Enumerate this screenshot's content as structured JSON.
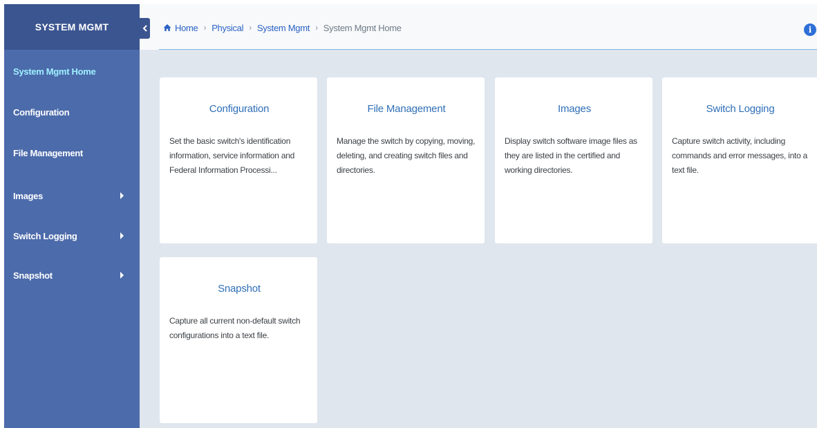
{
  "sidebar": {
    "title": "SYSTEM MGMT",
    "items": [
      {
        "label": "System Mgmt Home",
        "active": true,
        "has_submenu": false
      },
      {
        "label": "Configuration",
        "active": false,
        "has_submenu": false
      },
      {
        "label": "File Management",
        "active": false,
        "has_submenu": false
      },
      {
        "label": "Images",
        "active": false,
        "has_submenu": true
      },
      {
        "label": "Switch Logging",
        "active": false,
        "has_submenu": true
      },
      {
        "label": "Snapshot",
        "active": false,
        "has_submenu": true
      }
    ]
  },
  "breadcrumb": {
    "items": [
      "Home",
      "Physical",
      "System Mgmt",
      "System Mgmt Home"
    ]
  },
  "cards": [
    {
      "title": "Configuration",
      "description": "Set the basic switch's identification information, service information and Federal Information Processi..."
    },
    {
      "title": "File Management",
      "description": "Manage the switch by copying, moving, deleting, and creating switch files and directories."
    },
    {
      "title": "Images",
      "description": "Display switch software image files as they are listed in the certified and working directories."
    },
    {
      "title": "Switch Logging",
      "description": "Capture switch activity, including commands and error messages, into a text file."
    },
    {
      "title": "Snapshot",
      "description": "Capture all current non-default switch configurations into a text file."
    }
  ],
  "icons": {
    "home": "home-icon",
    "info": "info-icon",
    "collapse": "chevron-left-icon",
    "submenu": "caret-right-icon"
  },
  "colors": {
    "sidebar": "#4c6bab",
    "sidebar_header": "#3b5590",
    "active_item": "#9ff0ff",
    "link": "#2a62c4",
    "card_title": "#2f6fb7",
    "content_bg": "#dfe6ee"
  }
}
